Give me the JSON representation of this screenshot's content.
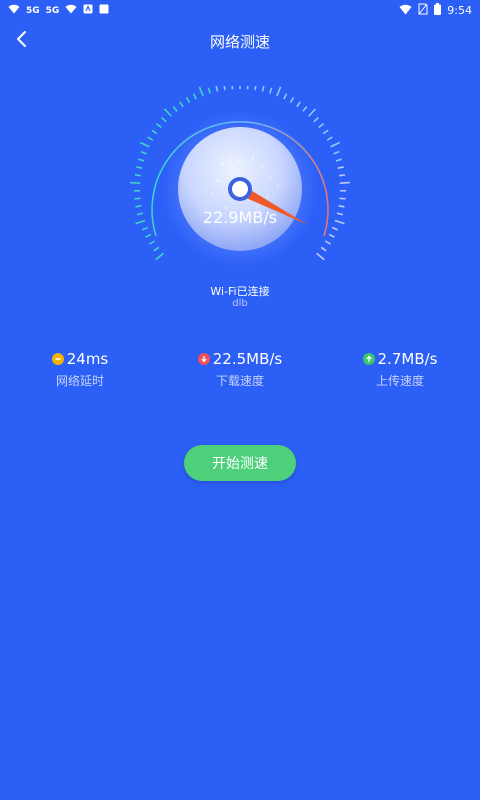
{
  "status_bar": {
    "left_labels": [
      "5G",
      "5G"
    ],
    "time": "9:54"
  },
  "header": {
    "title": "网络测速"
  },
  "gauge": {
    "speed_text": "22.9MB/s"
  },
  "connection": {
    "status": "Wi-Fi已连接",
    "ssid": "dlb"
  },
  "stats": [
    {
      "value": "24ms",
      "label": "网络延时",
      "icon": "minus-circle-icon",
      "color": "#f4b400"
    },
    {
      "value": "22.5MB/s",
      "label": "下载速度",
      "icon": "download-arrow-icon",
      "color": "#ef4e5a"
    },
    {
      "value": "2.7MB/s",
      "label": "上传速度",
      "icon": "upload-arrow-icon",
      "color": "#3cc86a"
    }
  ],
  "actions": {
    "start_label": "开始测速"
  },
  "colors": {
    "background": "#2c5ff6",
    "start_button": "#4ed07b",
    "needle": "#f05a2a"
  }
}
